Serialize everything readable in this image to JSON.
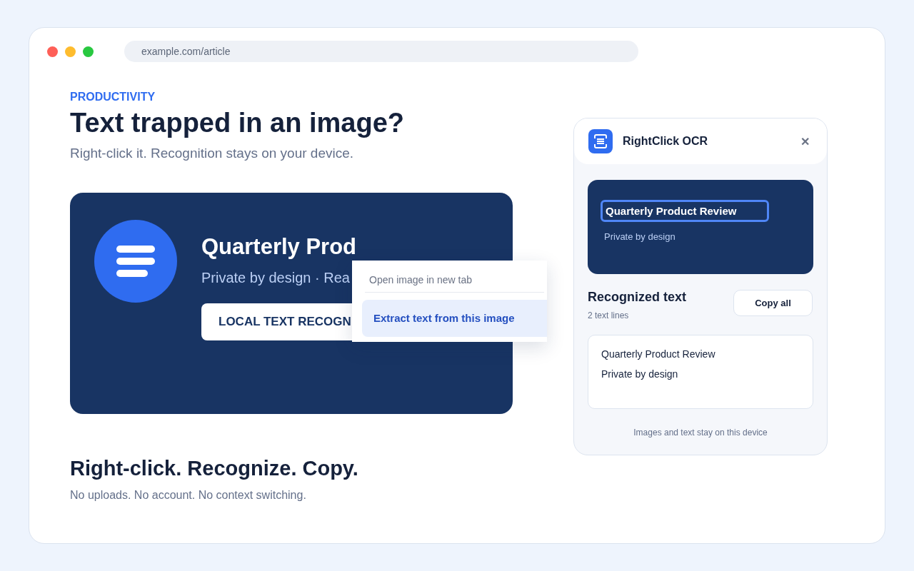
{
  "browser": {
    "address": "example.com/article"
  },
  "article": {
    "eyebrow": "PRODUCTIVITY",
    "title": "Text trapped in an image?",
    "subtitle": "Right-click it. Recognition stays on your device.",
    "image": {
      "title": "Quarterly Prod",
      "subtitle": "Private by design · Rea",
      "badge": "LOCAL TEXT RECOGN"
    },
    "section_title": "Right-click. Recognize. Copy.",
    "section_text": "No uploads. No account. No context switching."
  },
  "context_menu": {
    "items": [
      {
        "label": "Open image in new tab",
        "selected": false
      },
      {
        "label": "Extract text from this image",
        "selected": true
      }
    ]
  },
  "panel": {
    "title": "RightClick OCR",
    "close": "✕",
    "preview": {
      "lines": [
        {
          "text": "Quarterly Product Review",
          "highlighted": true
        },
        {
          "text": "Private by design",
          "highlighted": false
        }
      ]
    },
    "result_title": "Recognized text",
    "result_count": "2 text lines",
    "copy_button": "Copy all",
    "result_lines": [
      "Quarterly Product Review",
      "Private by design"
    ],
    "footer": "Images and text stay on this device"
  }
}
